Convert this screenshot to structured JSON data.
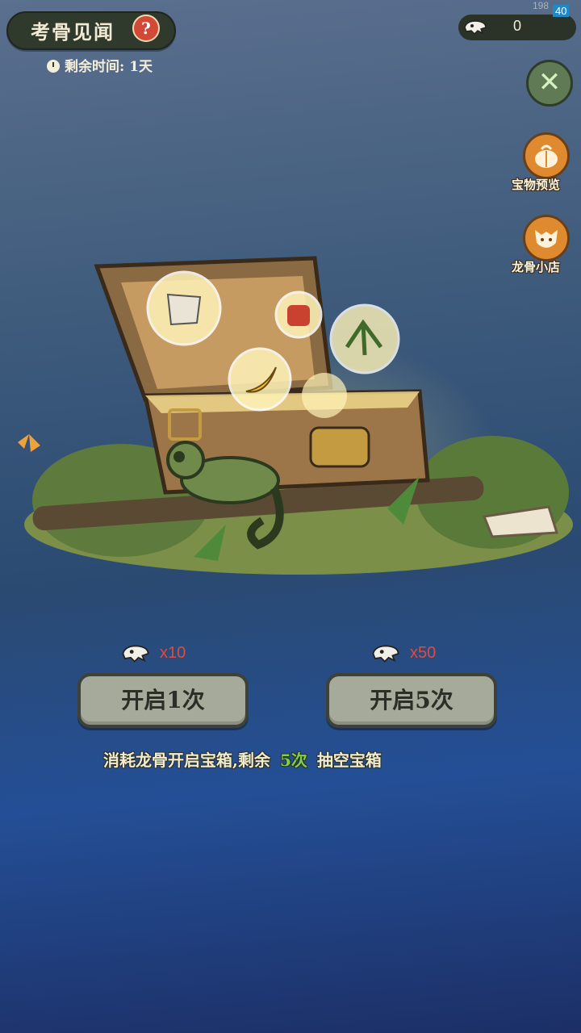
{
  "header": {
    "title": "考骨见闻",
    "help_symbol": "?",
    "timer_text": "剩余时间: 1天",
    "bone_count": "0",
    "fps": "40",
    "debug_digits": "198"
  },
  "sidebar": {
    "close_symbol": "✕",
    "items": [
      {
        "label": "宝物预览",
        "icon": "pumpkin-treasure-icon"
      },
      {
        "label": "龙骨小店",
        "icon": "fox-shop-icon"
      }
    ]
  },
  "actions": {
    "open_once": {
      "label": "开启1次",
      "cost": "x10"
    },
    "open_five": {
      "label": "开启5次",
      "cost": "x50"
    }
  },
  "info": {
    "prefix": "消耗龙骨开启宝箱,剩余",
    "remaining": "5次",
    "suffix": "抽空宝箱"
  },
  "colors": {
    "accent_red": "#e04b3a",
    "remaining_green": "#7fd04a",
    "close_green": "#5f7a54",
    "side_orange": "#e08a2f"
  }
}
